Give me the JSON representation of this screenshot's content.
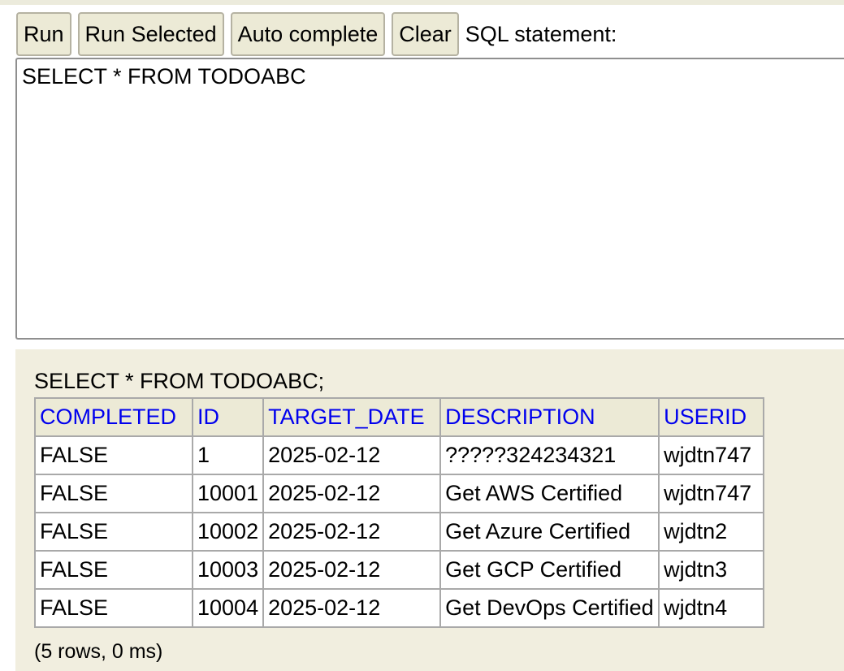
{
  "toolbar": {
    "run_label": "Run",
    "run_selected_label": "Run Selected",
    "autocomplete_label": "Auto complete",
    "clear_label": "Clear",
    "sql_statement_label": "SQL statement:"
  },
  "editor": {
    "value": "SELECT * FROM TODOABC"
  },
  "result": {
    "sql": "SELECT * FROM TODOABC;",
    "columns": [
      "COMPLETED",
      "ID",
      "TARGET_DATE",
      "DESCRIPTION",
      "USERID"
    ],
    "rows": [
      [
        "FALSE",
        "1",
        "2025-02-12",
        "?????324234321",
        "wjdtn747"
      ],
      [
        "FALSE",
        "10001",
        "2025-02-12",
        "Get AWS Certified",
        "wjdtn747"
      ],
      [
        "FALSE",
        "10002",
        "2025-02-12",
        "Get Azure Certified",
        "wjdtn2"
      ],
      [
        "FALSE",
        "10003",
        "2025-02-12",
        "Get GCP Certified",
        "wjdtn3"
      ],
      [
        "FALSE",
        "10004",
        "2025-02-12",
        "Get DevOps Certified",
        "wjdtn4"
      ]
    ],
    "footer": "(5 rows, 0 ms)"
  },
  "colors": {
    "panel_background": "#f1eedf",
    "button_background": "#ecead6",
    "header_link": "#0000ee"
  }
}
